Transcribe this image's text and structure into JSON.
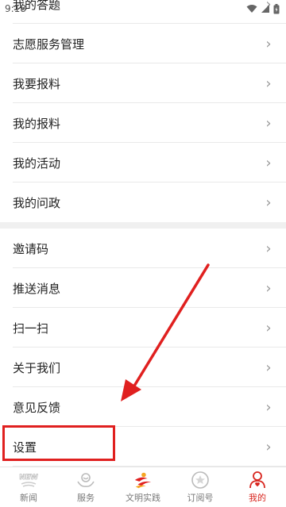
{
  "status_bar": {
    "time": "9:18"
  },
  "menu": {
    "group1": [
      {
        "label": "我的答题"
      },
      {
        "label": "志愿服务管理"
      },
      {
        "label": "我要报料"
      },
      {
        "label": "我的报料"
      },
      {
        "label": "我的活动"
      },
      {
        "label": "我的问政"
      }
    ],
    "group2": [
      {
        "label": "邀请码"
      },
      {
        "label": "推送消息"
      },
      {
        "label": "扫一扫"
      },
      {
        "label": "关于我们"
      },
      {
        "label": "意见反馈"
      },
      {
        "label": "设置"
      }
    ]
  },
  "tabbar": {
    "tabs": [
      {
        "label": "新闻",
        "icon": "new-icon"
      },
      {
        "label": "服务",
        "icon": "service-icon"
      },
      {
        "label": "文明实践",
        "icon": "civilization-icon"
      },
      {
        "label": "订阅号",
        "icon": "subscribe-icon"
      },
      {
        "label": "我的",
        "icon": "profile-icon"
      }
    ],
    "active_index": 4
  },
  "colors": {
    "accent": "#d8261f",
    "annotation": "#e0201f"
  }
}
